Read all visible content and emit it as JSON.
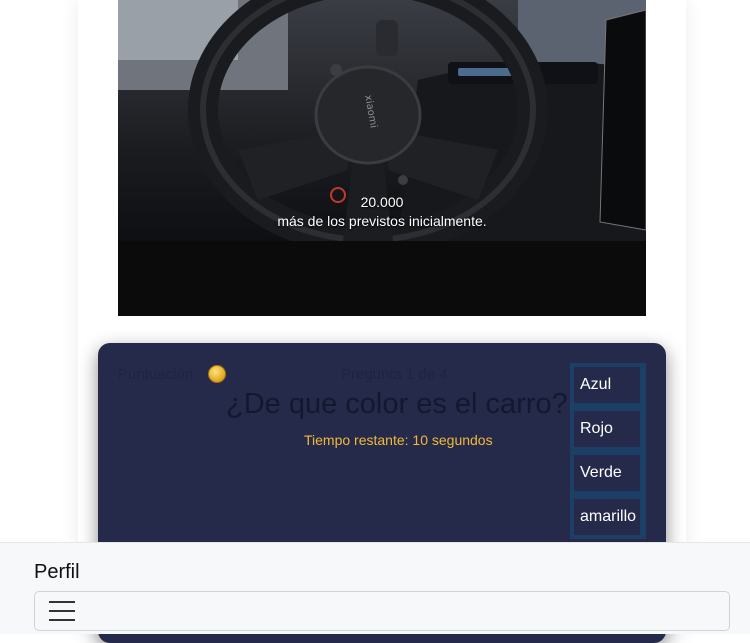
{
  "video": {
    "subtitle_line1": "20.000",
    "subtitle_line2": "más de los previstos inicialmente."
  },
  "quiz": {
    "score_label": "Puntuación:",
    "score_icon": "coin-icon",
    "question_counter": "Pregunta 1 de 4",
    "question": "¿De que color es el carro?",
    "timer": "Tiempo restante: 10 segundos",
    "options": [
      "Azul",
      "Rojo",
      "Verde",
      "amarillo"
    ]
  },
  "footer": {
    "title": "Perfil",
    "menu_icon": "hamburger-menu-icon"
  },
  "colors": {
    "quiz_background": "#252a4a",
    "options_border": "#1d3f66",
    "timer": "#f1b93a"
  }
}
